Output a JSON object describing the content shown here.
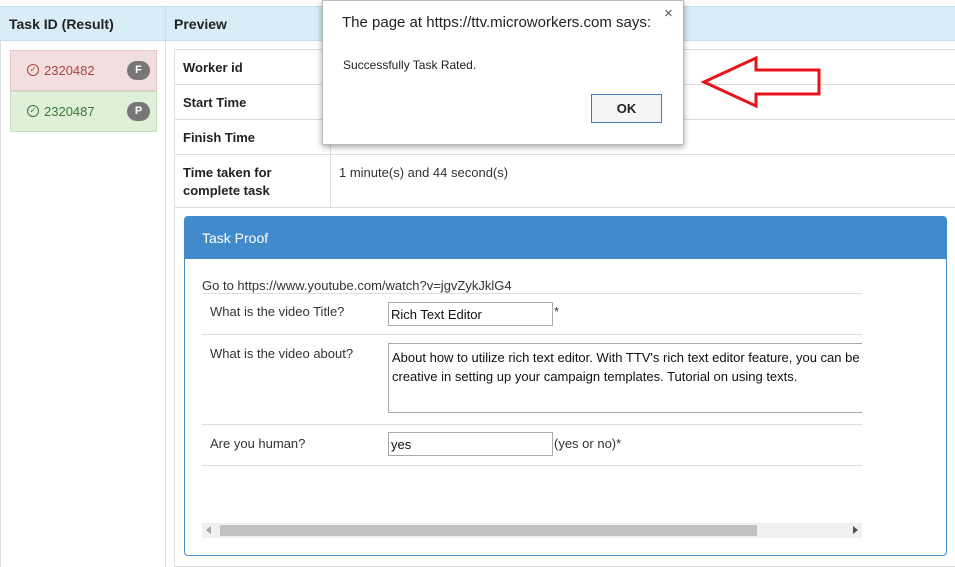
{
  "header": {
    "col1": "Task ID (Result)",
    "col2": "Preview"
  },
  "tasks": [
    {
      "id": "2320482",
      "badge": "F",
      "status": "fail"
    },
    {
      "id": "2320487",
      "badge": "P",
      "status": "pass"
    }
  ],
  "details": {
    "worker_id_label": "Worker id",
    "start_time_label": "Start Time",
    "finish_time_label": "Finish Time",
    "time_taken_label_line1": "Time taken for",
    "time_taken_label_line2": "complete task",
    "time_taken_value": "1 minute(s) and 44 second(s)"
  },
  "proof": {
    "title": "Task Proof",
    "goto": "Go to https://www.youtube.com/watch?v=jgvZykJklG4",
    "q1": "What is the video Title?",
    "a1": "Rich Text Editor",
    "a1_suffix": "*",
    "q2": "What is the video about?",
    "a2_line1": "About how to utilize rich text editor. With TTV's rich text editor feature, you can be",
    "a2_line2": "creative in setting up your campaign templates. Tutorial on using texts.",
    "q3": "Are you human?",
    "a3": "yes",
    "a3_suffix": "(yes or no)*"
  },
  "dialog": {
    "title": "The page at https://ttv.microworkers.com says:",
    "close": "×",
    "message": "Successfully Task Rated.",
    "ok_label": "OK"
  },
  "colors": {
    "header_bg": "#d9edf7",
    "fail_bg": "#f2dede",
    "pass_bg": "#dff0d8",
    "panel_blue": "#428bca",
    "arrow_red": "#e8141b"
  }
}
